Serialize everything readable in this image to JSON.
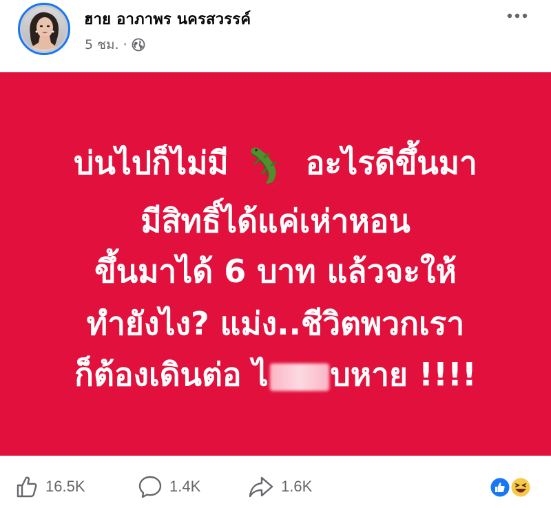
{
  "post": {
    "author_name": "ฮาย อาภาพร นครสวรรค์",
    "time": "5 ชม.",
    "separator": "·",
    "more_icon": "more-horizontal-icon",
    "privacy_icon": "globe-icon"
  },
  "image": {
    "background": "#e1103c",
    "text_color": "#ffffff",
    "lines": [
      {
        "a": "บ่นไปก็ไม่มี",
        "b": "อะไรดีขึ้นมา"
      },
      {
        "a": "มีสิทธิ์ได้แค่เห่าหอน"
      },
      {
        "a": "ขึ้นมาได้ 6 บาท  แล้วจะให้"
      },
      {
        "a": "ทำยังไง? แม่ง..ชีวิตพวกเรา"
      },
      {
        "a": "ก็ต้องเดินต่อ ไ",
        "b": "บหาย !!!!"
      }
    ],
    "emoji_icon": "crocodile-icon"
  },
  "footer": {
    "like_count": "16.5K",
    "comment_count": "1.4K",
    "share_count": "1.6K",
    "like_icon": "thumbs-up-icon",
    "comment_icon": "comment-icon",
    "share_icon": "share-icon",
    "reaction_icons": [
      "like-reaction-icon",
      "haha-reaction-icon"
    ],
    "accent": "#1877f2"
  }
}
